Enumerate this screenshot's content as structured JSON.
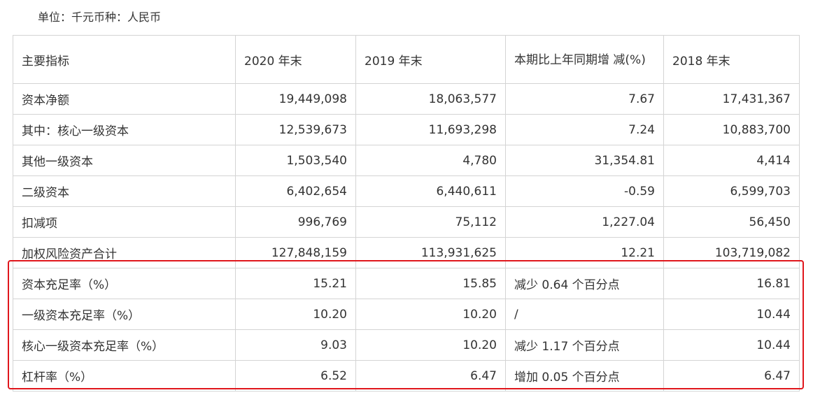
{
  "unit_label": "单位：千元币种：人民币",
  "headers": [
    "主要指标",
    "2020 年末",
    "2019 年末",
    "本期比上年同期增 减(%)",
    "2018 年末"
  ],
  "rows": [
    [
      "资本净额",
      "19,449,098",
      "18,063,577",
      "7.67",
      "17,431,367"
    ],
    [
      "其中：核心一级资本",
      "12,539,673",
      "11,693,298",
      "7.24",
      "10,883,700"
    ],
    [
      "其他一级资本",
      "1,503,540",
      "4,780",
      "31,354.81",
      "4,414"
    ],
    [
      "二级资本",
      "6,402,654",
      "6,440,611",
      "-0.59",
      "6,599,703"
    ],
    [
      "扣减项",
      "996,769",
      "75,112",
      "1,227.04",
      "56,450"
    ],
    [
      "加权风险资产合计",
      "127,848,159",
      "113,931,625",
      "12.21",
      "103,719,082"
    ],
    [
      "资本充足率（%）",
      "15.21",
      "15.85",
      "减少 0.64 个百分点",
      "16.81"
    ],
    [
      "一级资本充足率（%）",
      "10.20",
      "10.20",
      "/",
      "10.44"
    ],
    [
      "核心一级资本充足率（%）",
      "9.03",
      "10.20",
      "减少 1.17 个百分点",
      "10.44"
    ],
    [
      "杠杆率（%）",
      "6.52",
      "6.47",
      "增加 0.05 个百分点",
      "6.47"
    ]
  ],
  "highlight_color": "#e0161c"
}
